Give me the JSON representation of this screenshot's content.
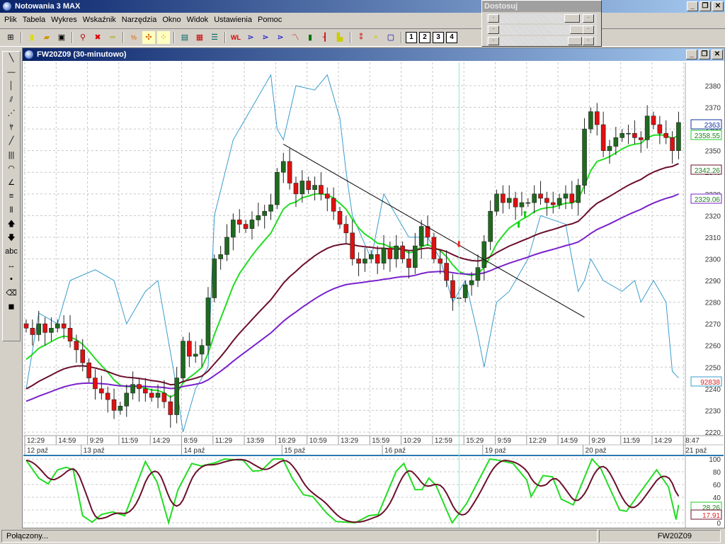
{
  "app": {
    "title": "Notowania 3 MAX"
  },
  "menu": [
    "Plik",
    "Tabela",
    "Wykres",
    "Wskaźnik",
    "Narzędzia",
    "Okno",
    "Widok",
    "Ustawienia",
    "Pomoc"
  ],
  "toolbar": {
    "layout_buttons": [
      "1",
      "2",
      "3",
      "4"
    ]
  },
  "left_tools_text": {
    "abc": "abc"
  },
  "panel": {
    "title": "Dostosuj"
  },
  "chart_window": {
    "title": "FW20Z09 (30-minutowo)"
  },
  "status": {
    "connection": "Połączony...",
    "symbol": "FW20Z09"
  },
  "chart_data": {
    "type": "candlestick",
    "ylim": [
      2215,
      2388
    ],
    "yticks": [
      2220,
      2230,
      2240,
      2250,
      2260,
      2270,
      2280,
      2290,
      2300,
      2310,
      2320,
      2330,
      2340,
      2350,
      2360,
      2370,
      2380
    ],
    "closes": [
      2268,
      2265,
      2270,
      2266,
      2268,
      2270,
      2268,
      2262,
      2258,
      2252,
      2245,
      2240,
      2238,
      2235,
      2230,
      2232,
      2238,
      2242,
      2240,
      2238,
      2236,
      2238,
      2234,
      2228,
      2245,
      2262,
      2255,
      2256,
      2260,
      2282,
      2300,
      2302,
      2310,
      2318,
      2316,
      2314,
      2318,
      2320,
      2322,
      2325,
      2340,
      2345,
      2335,
      2330,
      2336,
      2332,
      2334,
      2330,
      2328,
      2322,
      2316,
      2312,
      2300,
      2298,
      2300,
      2302,
      2298,
      2305,
      2300,
      2306,
      2300,
      2296,
      2306,
      2315,
      2310,
      2300,
      2298,
      2290,
      2282,
      2282,
      2288,
      2290,
      2296,
      2308,
      2322,
      2330,
      2326,
      2328,
      2324,
      2326,
      2326,
      2330,
      2328,
      2326,
      2325,
      2328,
      2330,
      2326,
      2334,
      2360,
      2368,
      2362,
      2350,
      2352,
      2356,
      2358,
      2358,
      2356,
      2355,
      2366,
      2362,
      2358,
      2356,
      2350,
      2363
    ],
    "first_open": 2270,
    "time_labels": [
      "12:29",
      "14:59",
      "9:29",
      "11:59",
      "14:29",
      "8:59",
      "11:29",
      "13:59",
      "16:29",
      "10:59",
      "13:29",
      "15:59",
      "10:29",
      "12:59",
      "15:29",
      "9:59",
      "12:29",
      "14:59",
      "9:29",
      "11:59",
      "14:29",
      "8:47"
    ],
    "date_labels": [
      {
        "label": "12 paź",
        "bar": 0
      },
      {
        "label": "13 paź",
        "bar": 9
      },
      {
        "label": "14 paź",
        "bar": 25
      },
      {
        "label": "15 paź",
        "bar": 41
      },
      {
        "label": "16 paź",
        "bar": 57
      },
      {
        "label": "19 paź",
        "bar": 73
      },
      {
        "label": "20 paź",
        "bar": 89
      },
      {
        "label": "21 paź",
        "bar": 105
      }
    ],
    "moving_averages": [
      {
        "name": "short",
        "color": "#22dd22",
        "period": 9,
        "seed": 2250,
        "last": "2358.55"
      },
      {
        "name": "mid",
        "color": "#6b0f2a",
        "period": 30,
        "seed": 2238,
        "last": "2342.26"
      },
      {
        "name": "long",
        "color": "#7a22cc",
        "period": 55,
        "seed": 2233,
        "last": "2329.06"
      }
    ],
    "last_price": "2363",
    "overlay_line": {
      "color": "#3a9ccc",
      "last": "92838",
      "points": [
        [
          0,
          2240
        ],
        [
          2,
          2275
        ],
        [
          5,
          2270
        ],
        [
          7,
          2290
        ],
        [
          11,
          2295
        ],
        [
          14,
          2290
        ],
        [
          16,
          2270
        ],
        [
          19,
          2285
        ],
        [
          21,
          2290
        ],
        [
          24,
          2240
        ],
        [
          25,
          2220
        ],
        [
          27,
          2240
        ],
        [
          29,
          2250
        ],
        [
          30,
          2320
        ],
        [
          33,
          2355
        ],
        [
          37,
          2375
        ],
        [
          39,
          2385
        ],
        [
          40,
          2360
        ],
        [
          41,
          2355
        ],
        [
          43,
          2380
        ],
        [
          46,
          2378
        ],
        [
          48,
          2385
        ],
        [
          50,
          2365
        ],
        [
          51,
          2340
        ],
        [
          52,
          2320
        ],
        [
          55,
          2300
        ],
        [
          57,
          2330
        ],
        [
          59,
          2320
        ],
        [
          61,
          2310
        ],
        [
          64,
          2310
        ],
        [
          66,
          2300
        ],
        [
          68,
          2280
        ],
        [
          70,
          2290
        ],
        [
          72,
          2265
        ],
        [
          73,
          2250
        ],
        [
          75,
          2280
        ],
        [
          77,
          2285
        ],
        [
          78,
          2290
        ],
        [
          80,
          2300
        ],
        [
          82,
          2320
        ],
        [
          86,
          2316
        ],
        [
          87,
          2300
        ],
        [
          88,
          2285
        ],
        [
          89,
          2290
        ],
        [
          90,
          2300
        ],
        [
          92,
          2290
        ],
        [
          95,
          2285
        ],
        [
          97,
          2290
        ],
        [
          98,
          2280
        ],
        [
          100,
          2290
        ],
        [
          102,
          2280
        ],
        [
          103,
          2248
        ],
        [
          104,
          2245
        ]
      ]
    },
    "trendline": [
      [
        41,
        2353
      ],
      [
        89,
        2273
      ]
    ],
    "crosshair_bar": 69,
    "signals": [
      {
        "type": "sell",
        "bar": 69,
        "price": 2307
      },
      {
        "type": "buy",
        "bar": 78.5,
        "price": 2316
      },
      {
        "type": "buy",
        "bar": 79.5,
        "price": 2321
      }
    ],
    "oscillator": {
      "ylim": [
        0,
        100
      ],
      "yticks": [
        0,
        20,
        40,
        60,
        80,
        100
      ],
      "k_color": "#22dd22",
      "d_color": "#6b0f2a",
      "k_last": "28.26",
      "d_last": "17.91",
      "k": [
        [
          0,
          98
        ],
        [
          2,
          70
        ],
        [
          3.5,
          61
        ],
        [
          5,
          83
        ],
        [
          6.4,
          87
        ],
        [
          7.5,
          83
        ],
        [
          9,
          11
        ],
        [
          10.5,
          1
        ],
        [
          12,
          13
        ],
        [
          13.8,
          17
        ],
        [
          15.7,
          11
        ],
        [
          19,
          96
        ],
        [
          20.9,
          63
        ],
        [
          22.7,
          0
        ],
        [
          24.2,
          52
        ],
        [
          26.4,
          93
        ],
        [
          27.9,
          89
        ],
        [
          30.1,
          94
        ],
        [
          31.6,
          100
        ],
        [
          34.6,
          98
        ],
        [
          36.1,
          81
        ],
        [
          37.5,
          82
        ],
        [
          39.4,
          100
        ],
        [
          40.9,
          100
        ],
        [
          42.4,
          70
        ],
        [
          44.2,
          44
        ],
        [
          45.7,
          41
        ],
        [
          47.9,
          15
        ],
        [
          49.4,
          2
        ],
        [
          52.4,
          0
        ],
        [
          54.6,
          11
        ],
        [
          56.1,
          13
        ],
        [
          59,
          81
        ],
        [
          60.2,
          93
        ],
        [
          62,
          52
        ],
        [
          63.1,
          52
        ],
        [
          64.2,
          70
        ],
        [
          65.3,
          59
        ],
        [
          67.9,
          0
        ],
        [
          70.2,
          30
        ],
        [
          73.9,
          100
        ],
        [
          75.3,
          98
        ],
        [
          77.6,
          93
        ],
        [
          79.8,
          67
        ],
        [
          80.5,
          41
        ],
        [
          82.4,
          74
        ],
        [
          83.9,
          72
        ],
        [
          85.3,
          37
        ],
        [
          87.2,
          28
        ],
        [
          90.2,
          100
        ],
        [
          91.6,
          85
        ],
        [
          94.6,
          20
        ],
        [
          95.7,
          18
        ],
        [
          97.9,
          48
        ],
        [
          100.5,
          83
        ],
        [
          102.4,
          56
        ],
        [
          103.6,
          5
        ],
        [
          104,
          28
        ]
      ]
    }
  }
}
